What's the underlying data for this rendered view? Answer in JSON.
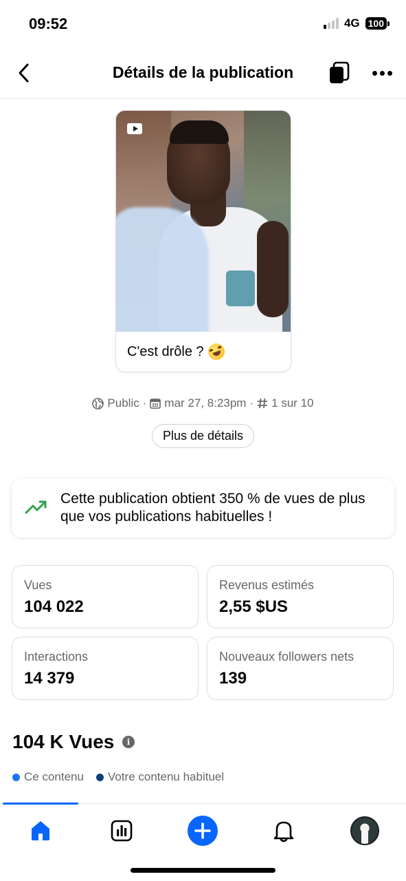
{
  "status_bar": {
    "time": "09:52",
    "network": "4G",
    "battery": "100"
  },
  "header": {
    "title": "Détails de la publication"
  },
  "post": {
    "caption": "C'est drôle ? "
  },
  "meta": {
    "visibility": "Public",
    "date": "mar 27, 8:23pm",
    "rank": "1 sur 10",
    "separator": "·"
  },
  "details_button": "Plus de détails",
  "insight": {
    "text": "Cette publication obtient 350 % de vues de plus que vos publications habituelles !"
  },
  "metrics": [
    {
      "label": "Vues",
      "value": "104 022"
    },
    {
      "label": "Revenus estimés",
      "value": "2,55 $US"
    },
    {
      "label": "Interactions",
      "value": "14 379"
    },
    {
      "label": "Nouveaux followers nets",
      "value": "139"
    }
  ],
  "views": {
    "title": "104 K Vues",
    "info_icon": "i",
    "legend": [
      {
        "label": "Ce contenu",
        "color": "#1877f2"
      },
      {
        "label": "Votre contenu habituel",
        "color": "#0a3d7a"
      }
    ]
  },
  "tabs": [
    "home-icon",
    "insights-icon",
    "create-icon",
    "notifications-icon",
    "profile-avatar"
  ],
  "colors": {
    "accent": "#0866ff",
    "trend": "#31a24c",
    "text_secondary": "#65676b"
  }
}
